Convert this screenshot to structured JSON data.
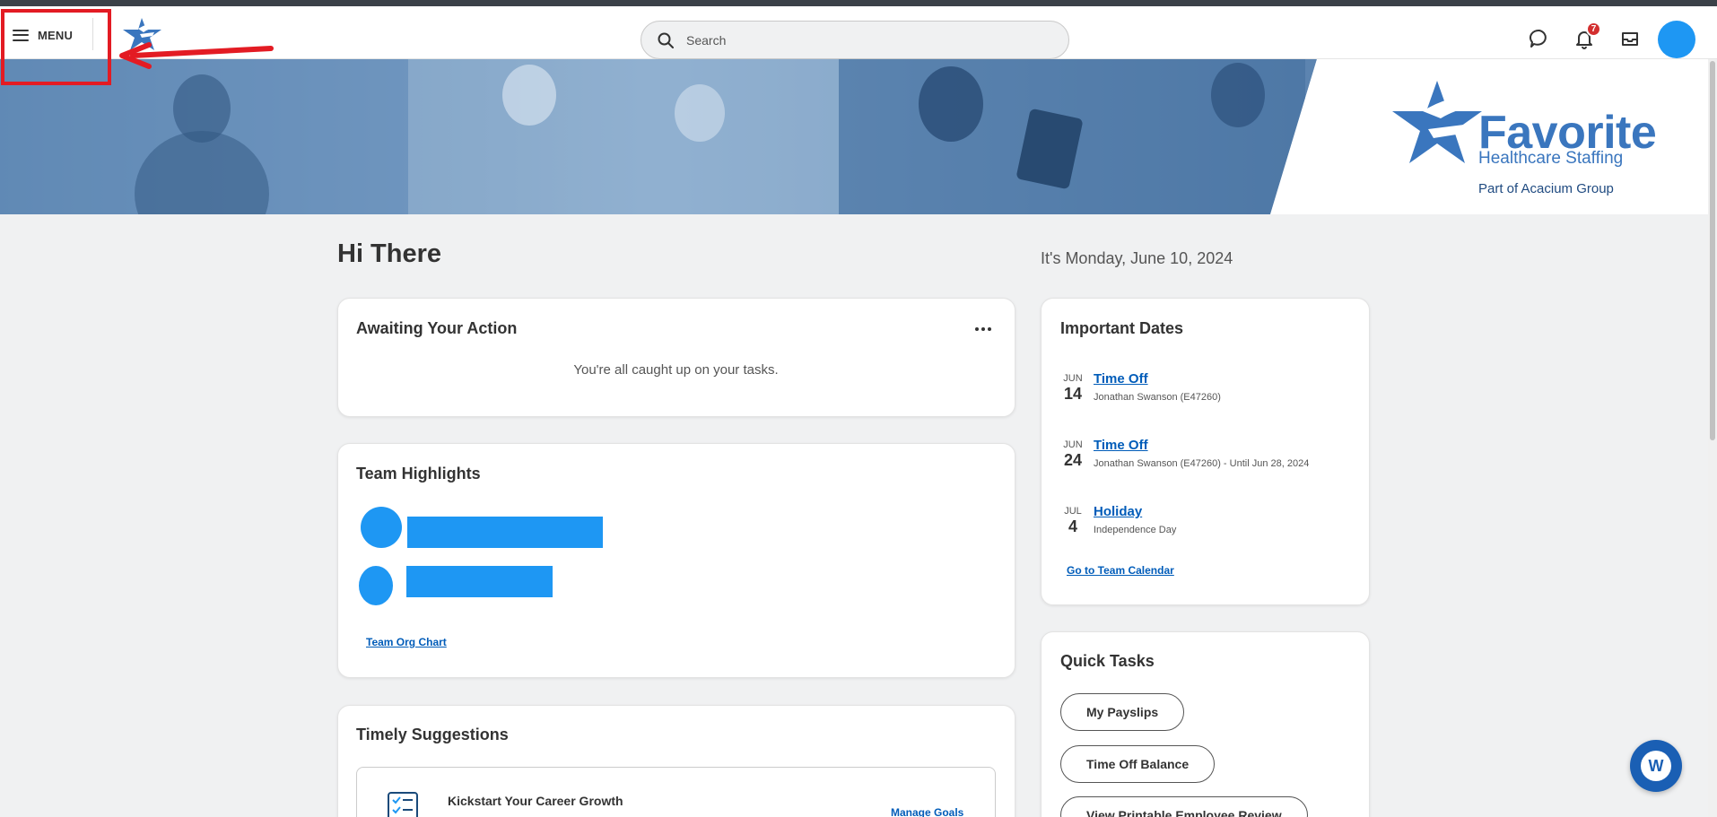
{
  "header": {
    "menu_label": "MENU",
    "search_placeholder": "Search",
    "notification_count": "7"
  },
  "banner": {
    "brand_name": "Favorite",
    "brand_sub": "Healthcare Staffing",
    "brand_part": "Part of Acacium Group"
  },
  "greeting": "Hi There",
  "date": "It's Monday, June 10, 2024",
  "awaiting": {
    "title": "Awaiting Your Action",
    "message": "You're all caught up on your tasks."
  },
  "team_highlights": {
    "title": "Team Highlights",
    "org_chart_link": "Team Org Chart"
  },
  "timely": {
    "title": "Timely Suggestions",
    "item_title": "Kickstart Your Career Growth",
    "item_link": "Manage Goals"
  },
  "important_dates": {
    "title": "Important Dates",
    "events": [
      {
        "mon": "JUN",
        "day": "14",
        "title": "Time Off",
        "sub": "Jonathan Swanson (E47260)"
      },
      {
        "mon": "JUN",
        "day": "24",
        "title": "Time Off",
        "sub": "Jonathan Swanson (E47260) - Until Jun 28, 2024"
      },
      {
        "mon": "JUL",
        "day": "4",
        "title": "Holiday",
        "sub": "Independence Day"
      }
    ],
    "calendar_link": "Go to Team Calendar"
  },
  "quick_tasks": {
    "title": "Quick Tasks",
    "buttons": [
      "My Payslips",
      "Time Off Balance",
      "View Printable Employee Review"
    ]
  },
  "chat": {
    "glyph": "W"
  },
  "colors": {
    "accent": "#1e97f3",
    "link": "#005cb9",
    "highlight": "#e31b23",
    "brand": "#3a76be"
  }
}
